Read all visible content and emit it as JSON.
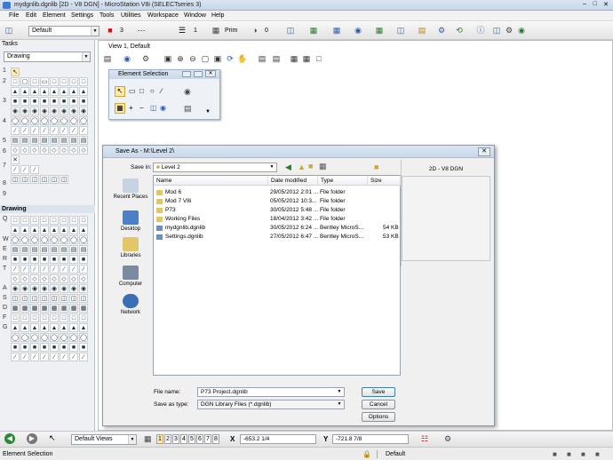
{
  "window": {
    "title": "mydgnlib.dgnlib [2D - V8 DGN] - MicroStation V8i (SELECTseries 3)"
  },
  "menu": [
    "File",
    "Edit",
    "Element",
    "Settings",
    "Tools",
    "Utilities",
    "Workspace",
    "Window",
    "Help"
  ],
  "toolbar": {
    "level_value": "Default",
    "color_value": "3",
    "weight_value": "1",
    "style_label": "Prim",
    "count_value": "0"
  },
  "tasks": {
    "title": "Tasks",
    "dropdown": "Drawing",
    "section2_title": "Drawing",
    "row_numbers": [
      "1",
      "2",
      "3",
      "4",
      "5",
      "6",
      "7",
      "8",
      "9"
    ],
    "row_numbers2": [
      "Q",
      "W",
      "E",
      "R",
      "T",
      "A",
      "S",
      "D",
      "F",
      "G"
    ]
  },
  "view": {
    "title": "View 1, Default"
  },
  "element_selection": {
    "title": "Element Selection"
  },
  "save_dialog": {
    "title": "Save As - M:\\Level 2\\",
    "save_in_label": "Save in:",
    "save_in_value": "Level 2",
    "places": [
      "Recent Places",
      "Desktop",
      "Libraries",
      "Computer",
      "Network"
    ],
    "columns": [
      "Name",
      "Date modified",
      "Type",
      "Size"
    ],
    "files": [
      {
        "name": "Mod 6",
        "date": "29/05/2012 2:01 ...",
        "type": "File folder",
        "size": "",
        "kind": "folder"
      },
      {
        "name": "Mod 7 V8i",
        "date": "05/05/2012 10:3...",
        "type": "File folder",
        "size": "",
        "kind": "folder"
      },
      {
        "name": "P73",
        "date": "30/05/2012 5:48 ...",
        "type": "File folder",
        "size": "",
        "kind": "folder"
      },
      {
        "name": "Working Files",
        "date": "18/04/2012 3:42 ...",
        "type": "File folder",
        "size": "",
        "kind": "folder"
      },
      {
        "name": "mydgnlib.dgnlib",
        "date": "30/05/2012 6:24 ...",
        "type": "Bentley MicroS...",
        "size": "54 KB",
        "kind": "file"
      },
      {
        "name": "Settings.dgnlib",
        "date": "27/05/2012 6:47 ...",
        "type": "Bentley MicroS...",
        "size": "53 KB",
        "kind": "file"
      }
    ],
    "preview_label": "2D - V8 DGN",
    "file_name_label": "File name:",
    "file_name_value": "P73 Project.dgnlib",
    "save_type_label": "Save as type:",
    "save_type_value": "DGN Library Files (*.dgnlib)",
    "save_button": "Save",
    "cancel_button": "Cancel",
    "options_button": "Options"
  },
  "bottom": {
    "views_value": "Default Views",
    "view_numbers": [
      "1",
      "2",
      "3",
      "4",
      "5",
      "6",
      "7",
      "8"
    ],
    "x_label": "X",
    "x_value": "-653.2 1/4",
    "y_label": "Y",
    "y_value": "-721.8 7/8"
  },
  "status": {
    "left": "Element Selection",
    "right": "Default"
  }
}
